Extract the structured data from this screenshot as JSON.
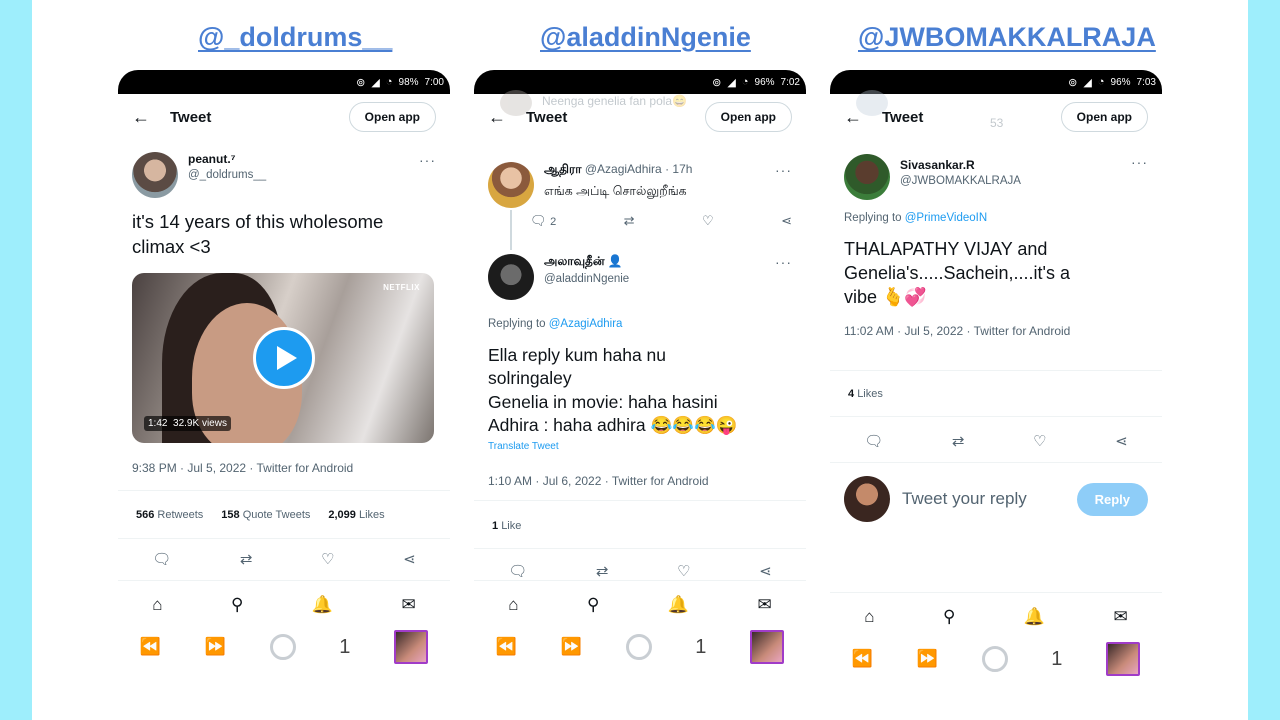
{
  "handles": [
    "@_doldrums__",
    "@aladdinNgenie",
    "@JWBOMAKKALRAJA"
  ],
  "colors": {
    "handle": "#4a7fd3",
    "accent": "#1d9bf0",
    "side_band": "#9eeefc"
  },
  "common": {
    "back_icon": "arrow-left-icon",
    "tweet_title": "Tweet",
    "open_app": "Open app",
    "tab_count": "1"
  },
  "panel1": {
    "status": {
      "battery": "98%",
      "time": "7:00"
    },
    "tweet": {
      "display_name": "peanut.⁷",
      "username": "@_doldrums__",
      "text": "it's 14 years of this wholesome climax <3",
      "video_badge": "NETFLIX",
      "video_duration": "1:42",
      "video_views": "32.9K views",
      "timestamp": "9:38 PM · Jul 5, 2022 · Twitter for Android"
    },
    "stats": {
      "retweets_count": "566",
      "retweets_label": "Retweets",
      "quotes_count": "158",
      "quotes_label": "Quote Tweets",
      "likes_count": "2,099",
      "likes_label": "Likes"
    }
  },
  "panel2": {
    "status": {
      "battery": "96%",
      "time": "7:02"
    },
    "ghost_text": "Neenga genelia fan pola😄",
    "parent": {
      "display_name": "ஆதிரா",
      "username": "@AzagiAdhira",
      "time": "· 17h",
      "text": "எங்க அப்டி சொல்லுறீங்க",
      "reply_count": "2"
    },
    "tweet": {
      "display_name": "அலாவுதீன் 👤",
      "username": "@aladdinNgenie",
      "replying_prefix": "Replying to",
      "replying_to": "@AzagiAdhira",
      "text_line1": "Ella reply kum haha nu",
      "text_line2": "solringaley",
      "text_line3": "Genelia in movie: haha hasini",
      "text_line4": "Adhira : haha adhira 😂😂😂😜",
      "translate": "Translate Tweet",
      "timestamp": "1:10 AM · Jul 6, 2022 · Twitter for Android"
    },
    "stats": {
      "likes_count": "1",
      "likes_label": "Like"
    }
  },
  "panel3": {
    "status": {
      "battery": "96%",
      "time": "7:03"
    },
    "ghost_text": "53",
    "tweet": {
      "display_name": "Sivasankar.R",
      "username": "@JWBOMAKKALRAJA",
      "replying_prefix": "Replying to",
      "replying_to": "@PrimeVideoIN",
      "text_line1": "THALAPATHY VIJAY and",
      "text_line2": "Genelia's.....Sachein,....it's a",
      "text_line3": "vibe 🫰💞",
      "timestamp": "11:02 AM · Jul 5, 2022 · Twitter for Android"
    },
    "stats": {
      "likes_count": "4",
      "likes_label": "Likes"
    },
    "reply": {
      "placeholder": "Tweet your reply",
      "button": "Reply"
    }
  }
}
